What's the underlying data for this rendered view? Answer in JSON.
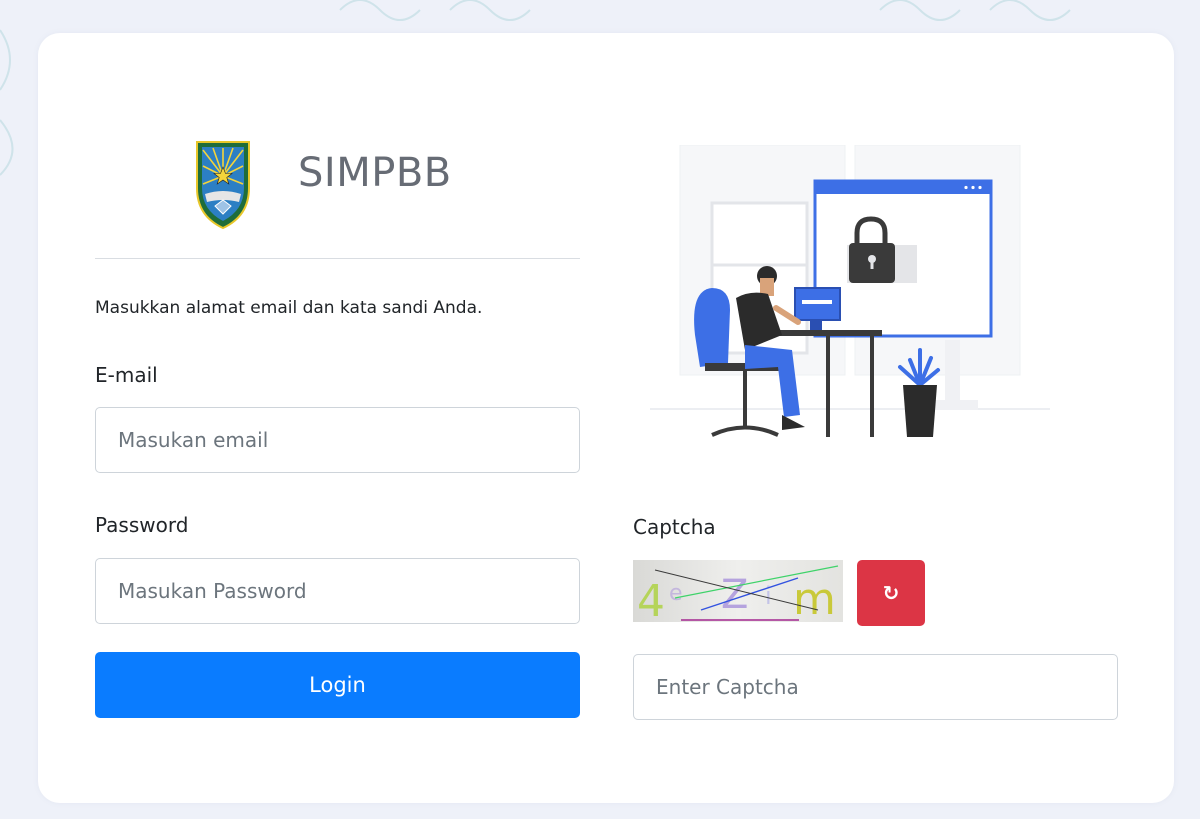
{
  "app": {
    "title": "SIMPBB"
  },
  "login": {
    "instruction": "Masukkan alamat email dan kata sandi Anda.",
    "email_label": "E-mail",
    "email_placeholder": "Masukan email",
    "password_label": "Password",
    "password_placeholder": "Masukan Password",
    "login_button": "Login"
  },
  "captcha": {
    "label": "Captcha",
    "image_text": "4eZim",
    "refresh_icon": "↻",
    "input_placeholder": "Enter Captcha"
  },
  "icons": {
    "logo": "regency-coat-of-arms-icon",
    "refresh": "refresh-icon",
    "illustration": "secure-login-illustration"
  },
  "colors": {
    "primary": "#0a7cff",
    "danger": "#dc3545",
    "background": "#eef1f9",
    "illustration_accent": "#3d6fe6"
  }
}
